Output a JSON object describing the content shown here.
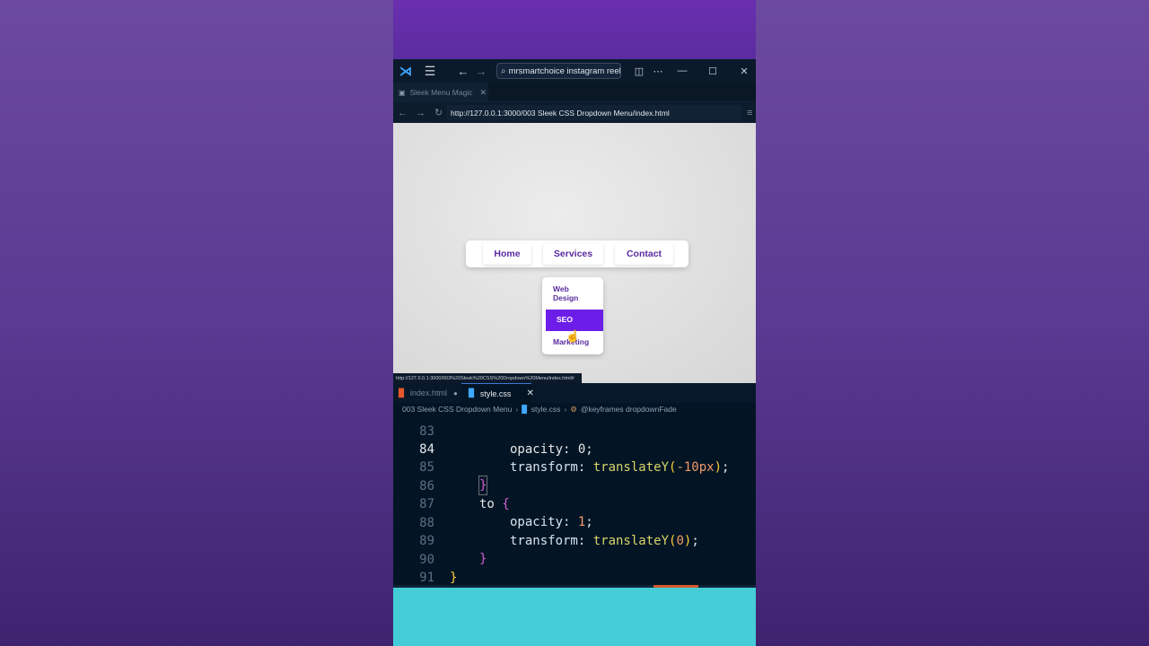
{
  "titlebar": {
    "search_text": "mrsmartchoice instagram reels"
  },
  "preview_tab": {
    "label": "Sleek Menu Magic"
  },
  "browser": {
    "url": "http://127.0.0.1:3000/003 Sleek CSS Dropdown Menu/index.html"
  },
  "page": {
    "nav": [
      "Home",
      "Services",
      "Contact"
    ],
    "dropdown": [
      "Web Design",
      "SEO",
      "Marketing"
    ]
  },
  "status_url": "http://127.0.0.1:3000/003%20Sleek%20CSS%20Dropdown%20Menu/index.html#",
  "editor": {
    "tabs": [
      {
        "label": "index.html"
      },
      {
        "label": "style.css"
      }
    ],
    "breadcrumbs": {
      "folder": "003 Sleek CSS Dropdown Menu",
      "file": "style.css",
      "symbol": "@keyframes dropdownFade"
    },
    "lines": [
      {
        "num": "83",
        "text": "opacity: 0;"
      },
      {
        "num": "84",
        "text": "transform: translateY(-10px);"
      },
      {
        "num": "85",
        "text": "}"
      },
      {
        "num": "86",
        "text": "to {"
      },
      {
        "num": "87",
        "text": "opacity: 1;"
      },
      {
        "num": "88",
        "text": "transform: translateY(0);"
      },
      {
        "num": "89",
        "text": "}"
      },
      {
        "num": "90",
        "text": "}"
      },
      {
        "num": "91",
        "text": ""
      }
    ]
  },
  "colors": {
    "accent": "#6c1ee8",
    "nav_text": "#5a2aa0",
    "editor_bg": "#031525",
    "background_purple": "#5a3a92",
    "teal": "#44cdd6"
  }
}
